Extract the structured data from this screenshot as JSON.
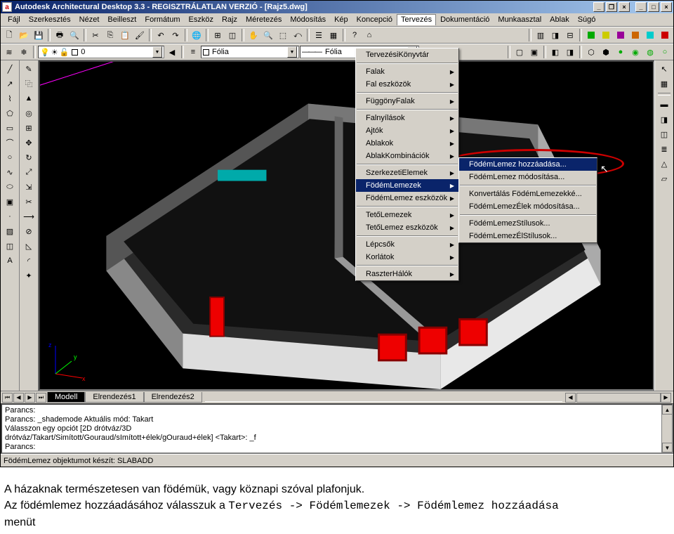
{
  "title": "Autodesk Architectural Desktop 3.3 - REGISZTRÁLATLAN VERZIÓ - [Rajz5.dwg]",
  "menubar": [
    "Fájl",
    "Szerkesztés",
    "Nézet",
    "Beilleszt",
    "Formátum",
    "Eszköz",
    "Rajz",
    "Méretezés",
    "Módosítás",
    "Kép",
    "Koncepció",
    "Tervezés",
    "Dokumentáció",
    "Munkaasztal",
    "Ablak",
    "Súgó"
  ],
  "layer_combo": "0",
  "linetype_combo1": "Fólia",
  "linetype_combo2": "Fólia",
  "tabs": {
    "controls": [
      "⏮",
      "◀",
      "▶",
      "⏭"
    ],
    "items": [
      "Modell",
      "Elrendezés1",
      "Elrendezés2"
    ],
    "active": 0
  },
  "cmdlines": [
    "Parancs:",
    "Parancs: _shademode Aktuális mód: Takart",
    "Válasszon egy opciót [2D drótváz/3D",
    "drótváz/Takart/Simított/Gouraud/sImított+élek/gOuraud+élek] <Takart>: _f",
    "Parancs:"
  ],
  "statusbar": "FödémLemez objektumot készít: SLABADD",
  "menu1": {
    "groups": [
      [
        "TervezésiKönyvtár"
      ],
      [
        "Falak",
        "Fal eszközök"
      ],
      [
        "FüggönyFalak"
      ],
      [
        "Falnyílások",
        "Ajtók",
        "Ablakok",
        "AblakKombinációk"
      ],
      [
        "SzerkezetiElemek",
        "FödémLemezek",
        "FödémLemez eszközök"
      ],
      [
        "TetőLemezek",
        "TetőLemez eszközök"
      ],
      [
        "Lépcsők",
        "Korlátok"
      ],
      [
        "RaszterHálók"
      ]
    ],
    "highlight": "FödémLemezek"
  },
  "menu2": {
    "groups": [
      [
        "FödémLemez hozzáadása...",
        "FödémLemez módosítása..."
      ],
      [
        "Konvertálás FödémLemezekké...",
        "FödémLemezÉlek módosítása..."
      ],
      [
        "FödémLemezStílusok...",
        "FödémLemezÉlStílusok..."
      ]
    ],
    "highlight": "FödémLemez hozzáadása..."
  },
  "axis": {
    "x": "x",
    "y": "y",
    "z": "z"
  },
  "caption": {
    "line1": "A házaknak természetesen van födémük, vagy köznapi szóval plafonjuk.",
    "line2a": "Az födémlemez hozzáadásához válasszuk a ",
    "line2b": "Tervezés -> Födémlemezek -> Födémlemez hozzáadása",
    "line3": "menüt"
  }
}
